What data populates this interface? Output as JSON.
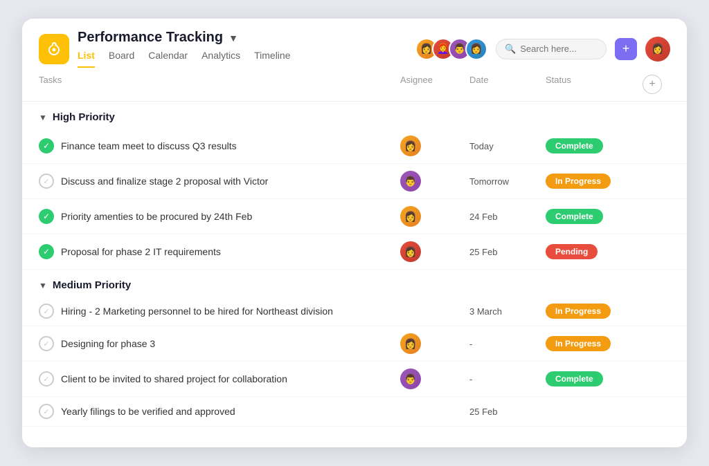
{
  "app": {
    "logo_char": "🔔",
    "project_title": "Performance Tracking",
    "nav_tabs": [
      {
        "label": "List",
        "active": true
      },
      {
        "label": "Board",
        "active": false
      },
      {
        "label": "Calendar",
        "active": false
      },
      {
        "label": "Analytics",
        "active": false
      },
      {
        "label": "Timeline",
        "active": false
      }
    ]
  },
  "header": {
    "search_placeholder": "Search here...",
    "add_button_label": "+",
    "avatars": [
      {
        "color": "av1",
        "face": "👩"
      },
      {
        "color": "av2",
        "face": "👩‍🦰"
      },
      {
        "color": "av3",
        "face": "👨"
      },
      {
        "color": "av4",
        "face": "👩"
      }
    ]
  },
  "table": {
    "columns": {
      "tasks": "Tasks",
      "assignee": "Asignee",
      "date": "Date",
      "status": "Status"
    },
    "sections": [
      {
        "id": "high-priority",
        "label": "High Priority",
        "tasks": [
          {
            "id": 1,
            "name": "Finance team meet to discuss Q3 results",
            "checked": true,
            "check_type": "green",
            "assignee_color": "a1",
            "assignee_face": "👩",
            "date": "Today",
            "status": "Complete",
            "status_type": "complete"
          },
          {
            "id": 2,
            "name": "Discuss and finalize stage 2 proposal with Victor",
            "checked": false,
            "check_type": "gray",
            "assignee_color": "a2",
            "assignee_face": "👨",
            "date": "Tomorrow",
            "status": "In Progress",
            "status_type": "in-progress"
          },
          {
            "id": 3,
            "name": "Priority amenties to be procured by 24th Feb",
            "checked": true,
            "check_type": "green",
            "assignee_color": "a1",
            "assignee_face": "👩",
            "date": "24 Feb",
            "status": "Complete",
            "status_type": "complete"
          },
          {
            "id": 4,
            "name": "Proposal for phase 2 IT requirements",
            "checked": true,
            "check_type": "green",
            "assignee_color": "a3",
            "assignee_face": "👩",
            "date": "25 Feb",
            "status": "Pending",
            "status_type": "pending"
          }
        ]
      },
      {
        "id": "medium-priority",
        "label": "Medium Priority",
        "tasks": [
          {
            "id": 5,
            "name": "Hiring - 2 Marketing personnel to be hired for Northeast division",
            "checked": false,
            "check_type": "gray",
            "assignee_color": "",
            "assignee_face": "",
            "date": "3 March",
            "status": "In Progress",
            "status_type": "in-progress"
          },
          {
            "id": 6,
            "name": "Designing for phase 3",
            "checked": false,
            "check_type": "gray",
            "assignee_color": "a1",
            "assignee_face": "👩",
            "date": "-",
            "status": "In Progress",
            "status_type": "in-progress"
          },
          {
            "id": 7,
            "name": "Client to be invited to shared project for collaboration",
            "checked": false,
            "check_type": "gray",
            "assignee_color": "a2",
            "assignee_face": "👨",
            "date": "-",
            "status": "Complete",
            "status_type": "complete"
          },
          {
            "id": 8,
            "name": "Yearly filings to be verified and approved",
            "checked": false,
            "check_type": "gray",
            "assignee_color": "",
            "assignee_face": "",
            "date": "25 Feb",
            "status": "",
            "status_type": ""
          }
        ]
      }
    ]
  }
}
